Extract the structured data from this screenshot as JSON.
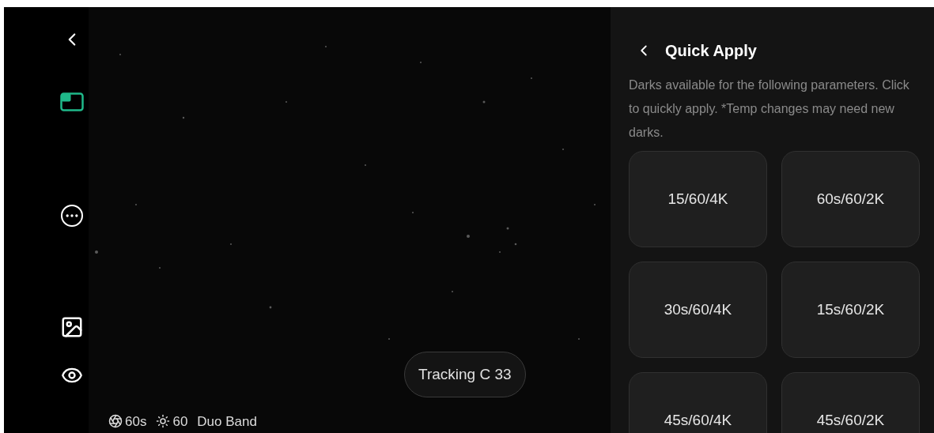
{
  "sidebar": {
    "items": [
      {
        "kind": "back",
        "selected": false
      },
      {
        "kind": "layout",
        "selected": true
      },
      {
        "kind": "more",
        "selected": false
      },
      {
        "kind": "gallery",
        "selected": false
      },
      {
        "kind": "eye",
        "selected": false
      }
    ]
  },
  "viewer": {
    "tracking_button": "Tracking C 33",
    "status": [
      {
        "kind": "exposure",
        "text": "60s"
      },
      {
        "kind": "gain",
        "text": "60"
      },
      {
        "kind": "filter",
        "text": "Duo Band"
      }
    ]
  },
  "panel": {
    "title": "Quick Apply",
    "description": "Darks available for the following parameters. Click to quickly apply. *Temp changes may need new darks.",
    "presets": [
      "15/60/4K",
      "60s/60/2K",
      "30s/60/4K",
      "15s/60/2K",
      "45s/60/4K",
      "45s/60/2K"
    ]
  }
}
